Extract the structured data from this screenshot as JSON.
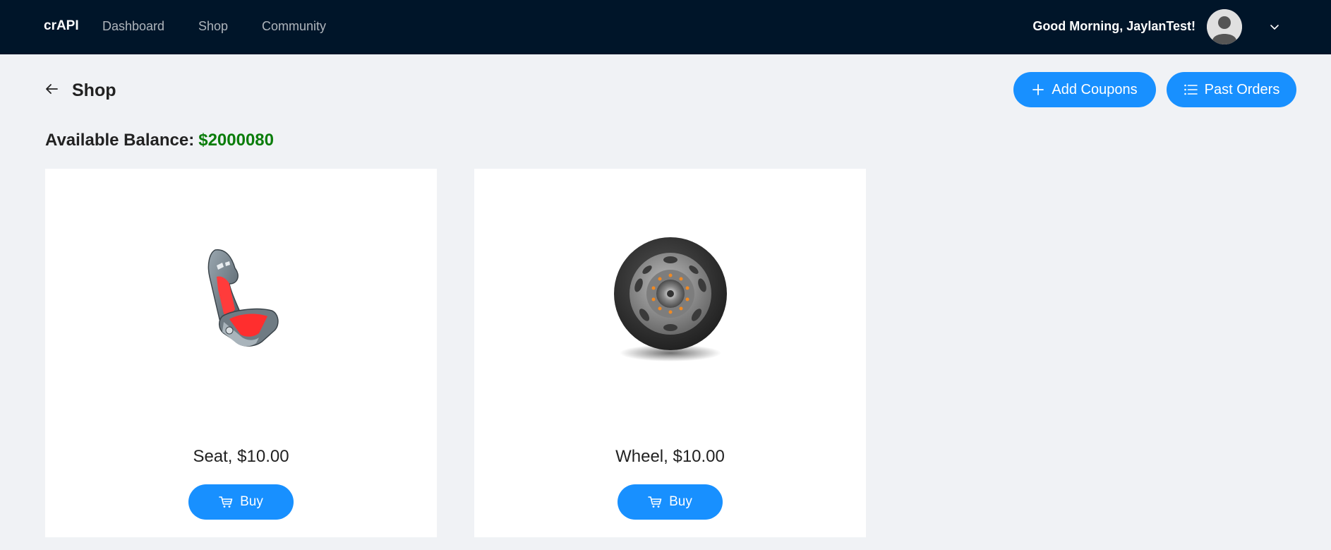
{
  "header": {
    "brand": "crAPI",
    "nav": {
      "dashboard": "Dashboard",
      "shop": "Shop",
      "community": "Community"
    },
    "greeting": "Good Morning, JaylanTest!",
    "icons": {
      "avatar": "user-avatar",
      "dropdown": "chevron-down-icon"
    }
  },
  "page": {
    "title": "Shop",
    "back_icon": "arrow-left-icon",
    "actions": {
      "add_coupons": "Add Coupons",
      "past_orders": "Past Orders"
    },
    "balance": {
      "label": "Available Balance:",
      "amount": "$2000080"
    }
  },
  "products": [
    {
      "label": "Seat, $10.00",
      "image": "car-seat-image",
      "buy": "Buy"
    },
    {
      "label": "Wheel, $10.00",
      "image": "car-wheel-image",
      "buy": "Buy"
    }
  ],
  "colors": {
    "header_bg": "#001529",
    "accent": "#1890ff",
    "balance": "#0b7d0b",
    "page_bg": "#f0f2f5"
  }
}
